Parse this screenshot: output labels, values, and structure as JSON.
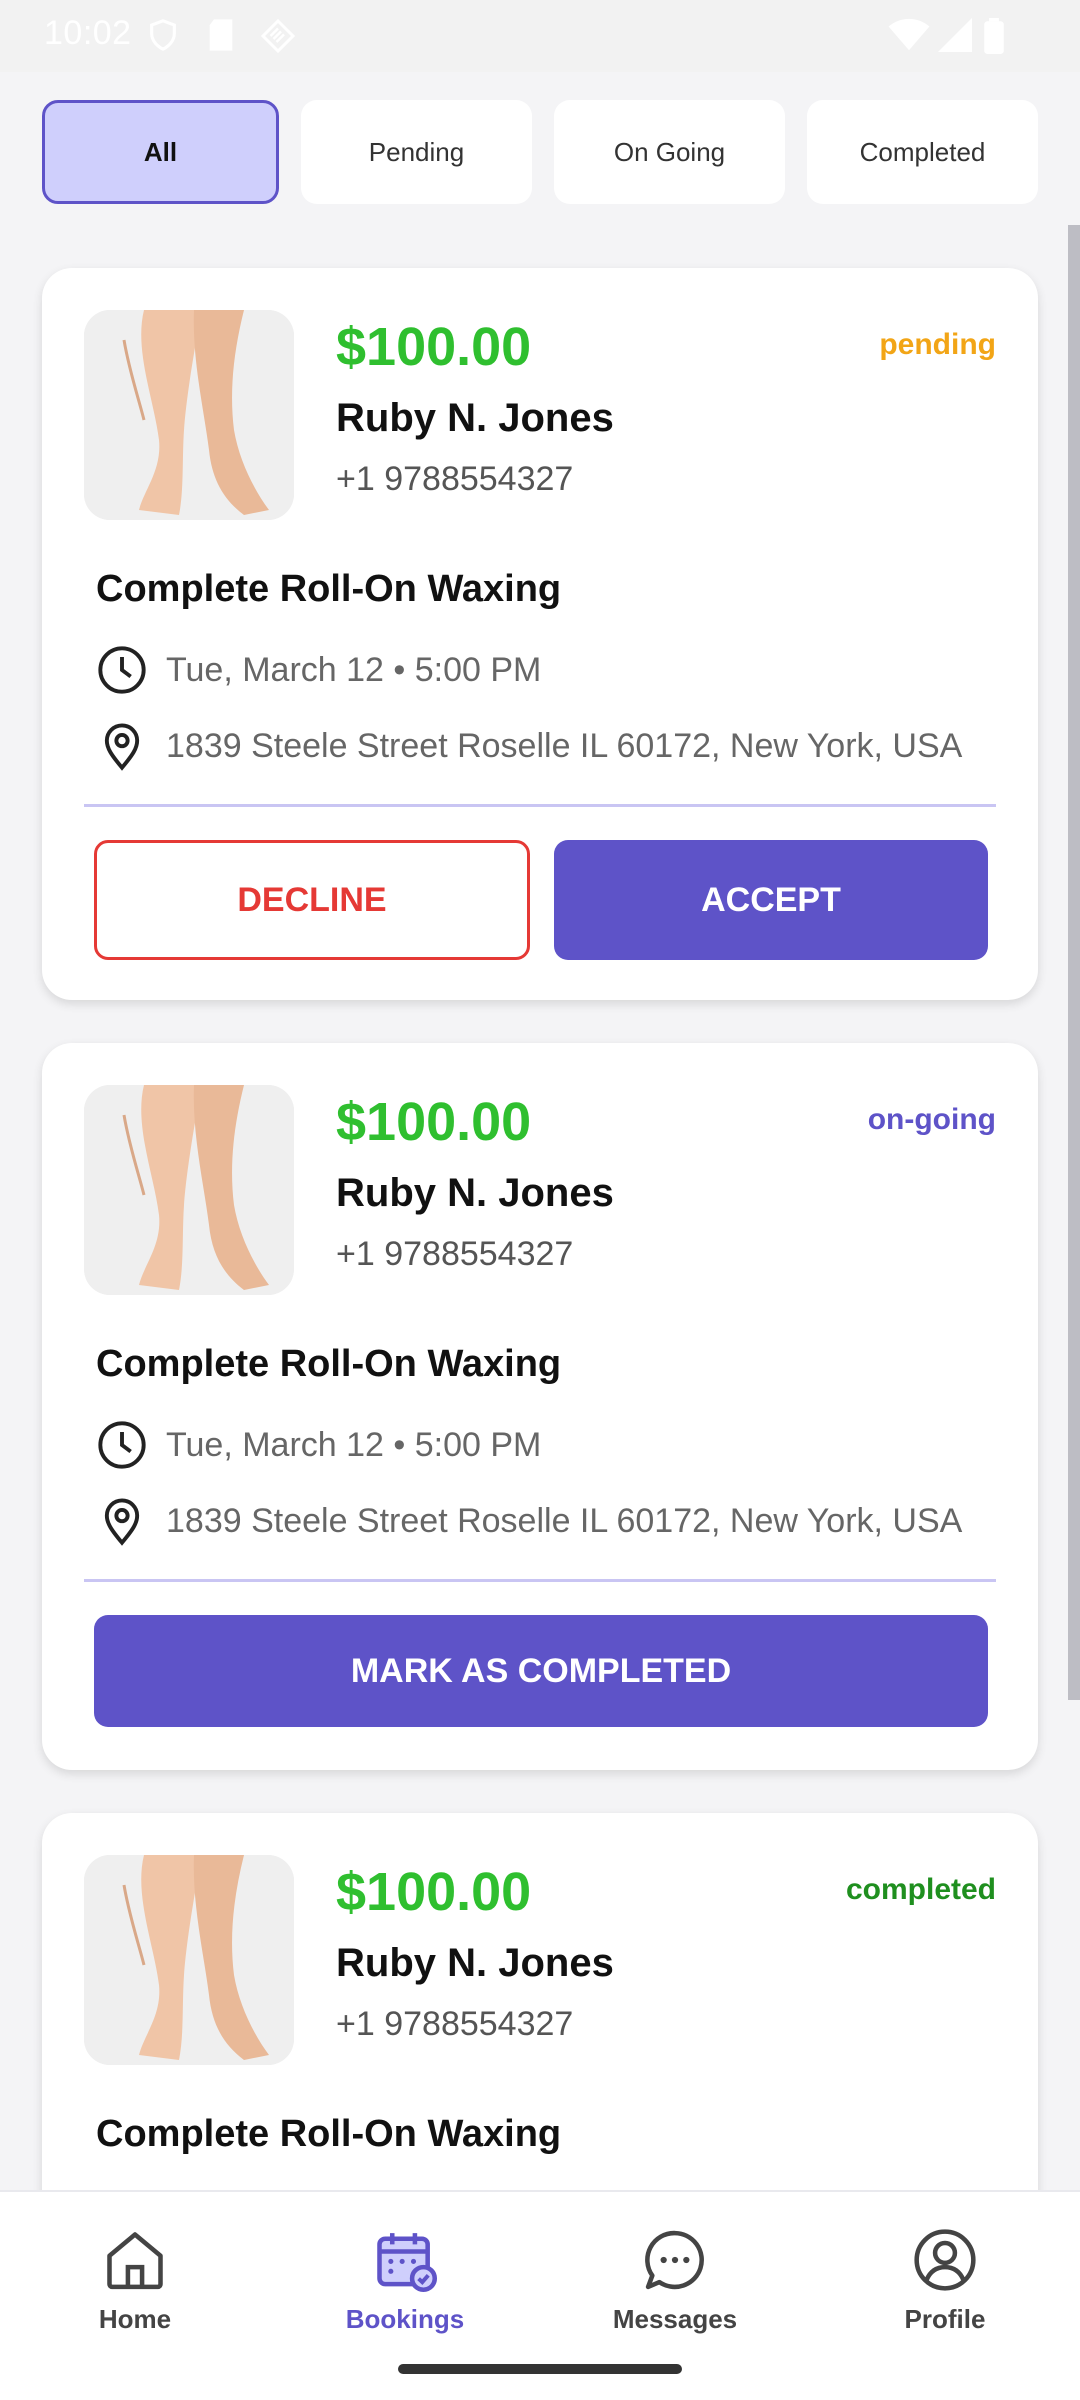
{
  "status_bar": {
    "time": "10:02"
  },
  "filters": [
    {
      "label": "All",
      "active": true
    },
    {
      "label": "Pending",
      "active": false
    },
    {
      "label": "On Going",
      "active": false
    },
    {
      "label": "Completed",
      "active": false
    }
  ],
  "cards": [
    {
      "price": "$100.00",
      "status": "pending",
      "status_color": "#f2a516",
      "name": "Ruby N. Jones",
      "phone": "+1 9788554327",
      "service": "Complete Roll-On Waxing",
      "datetime": "Tue, March 12 • 5:00 PM",
      "address": "1839 Steele Street Roselle IL 60172, New York, USA",
      "decline_label": "DECLINE",
      "accept_label": "ACCEPT"
    },
    {
      "price": "$100.00",
      "status": "on-going",
      "status_color": "#5e53c8",
      "name": "Ruby N. Jones",
      "phone": "+1 9788554327",
      "service": "Complete Roll-On Waxing",
      "datetime": "Tue, March 12 • 5:00 PM",
      "address": "1839 Steele Street Roselle IL 60172, New York, USA",
      "complete_label": "MARK AS COMPLETED"
    },
    {
      "price": "$100.00",
      "status": "completed",
      "status_color": "#1f8f1f",
      "name": "Ruby N. Jones",
      "phone": "+1 9788554327",
      "service": "Complete Roll-On Waxing"
    }
  ],
  "nav": {
    "items": [
      {
        "label": "Home",
        "icon": "home-icon"
      },
      {
        "label": "Bookings",
        "icon": "calendar-icon",
        "active": true
      },
      {
        "label": "Messages",
        "icon": "chat-icon"
      },
      {
        "label": "Profile",
        "icon": "profile-icon"
      }
    ]
  },
  "colors": {
    "accent": "#5e53c8",
    "price": "#2fbf2f",
    "decline": "#e53935"
  }
}
